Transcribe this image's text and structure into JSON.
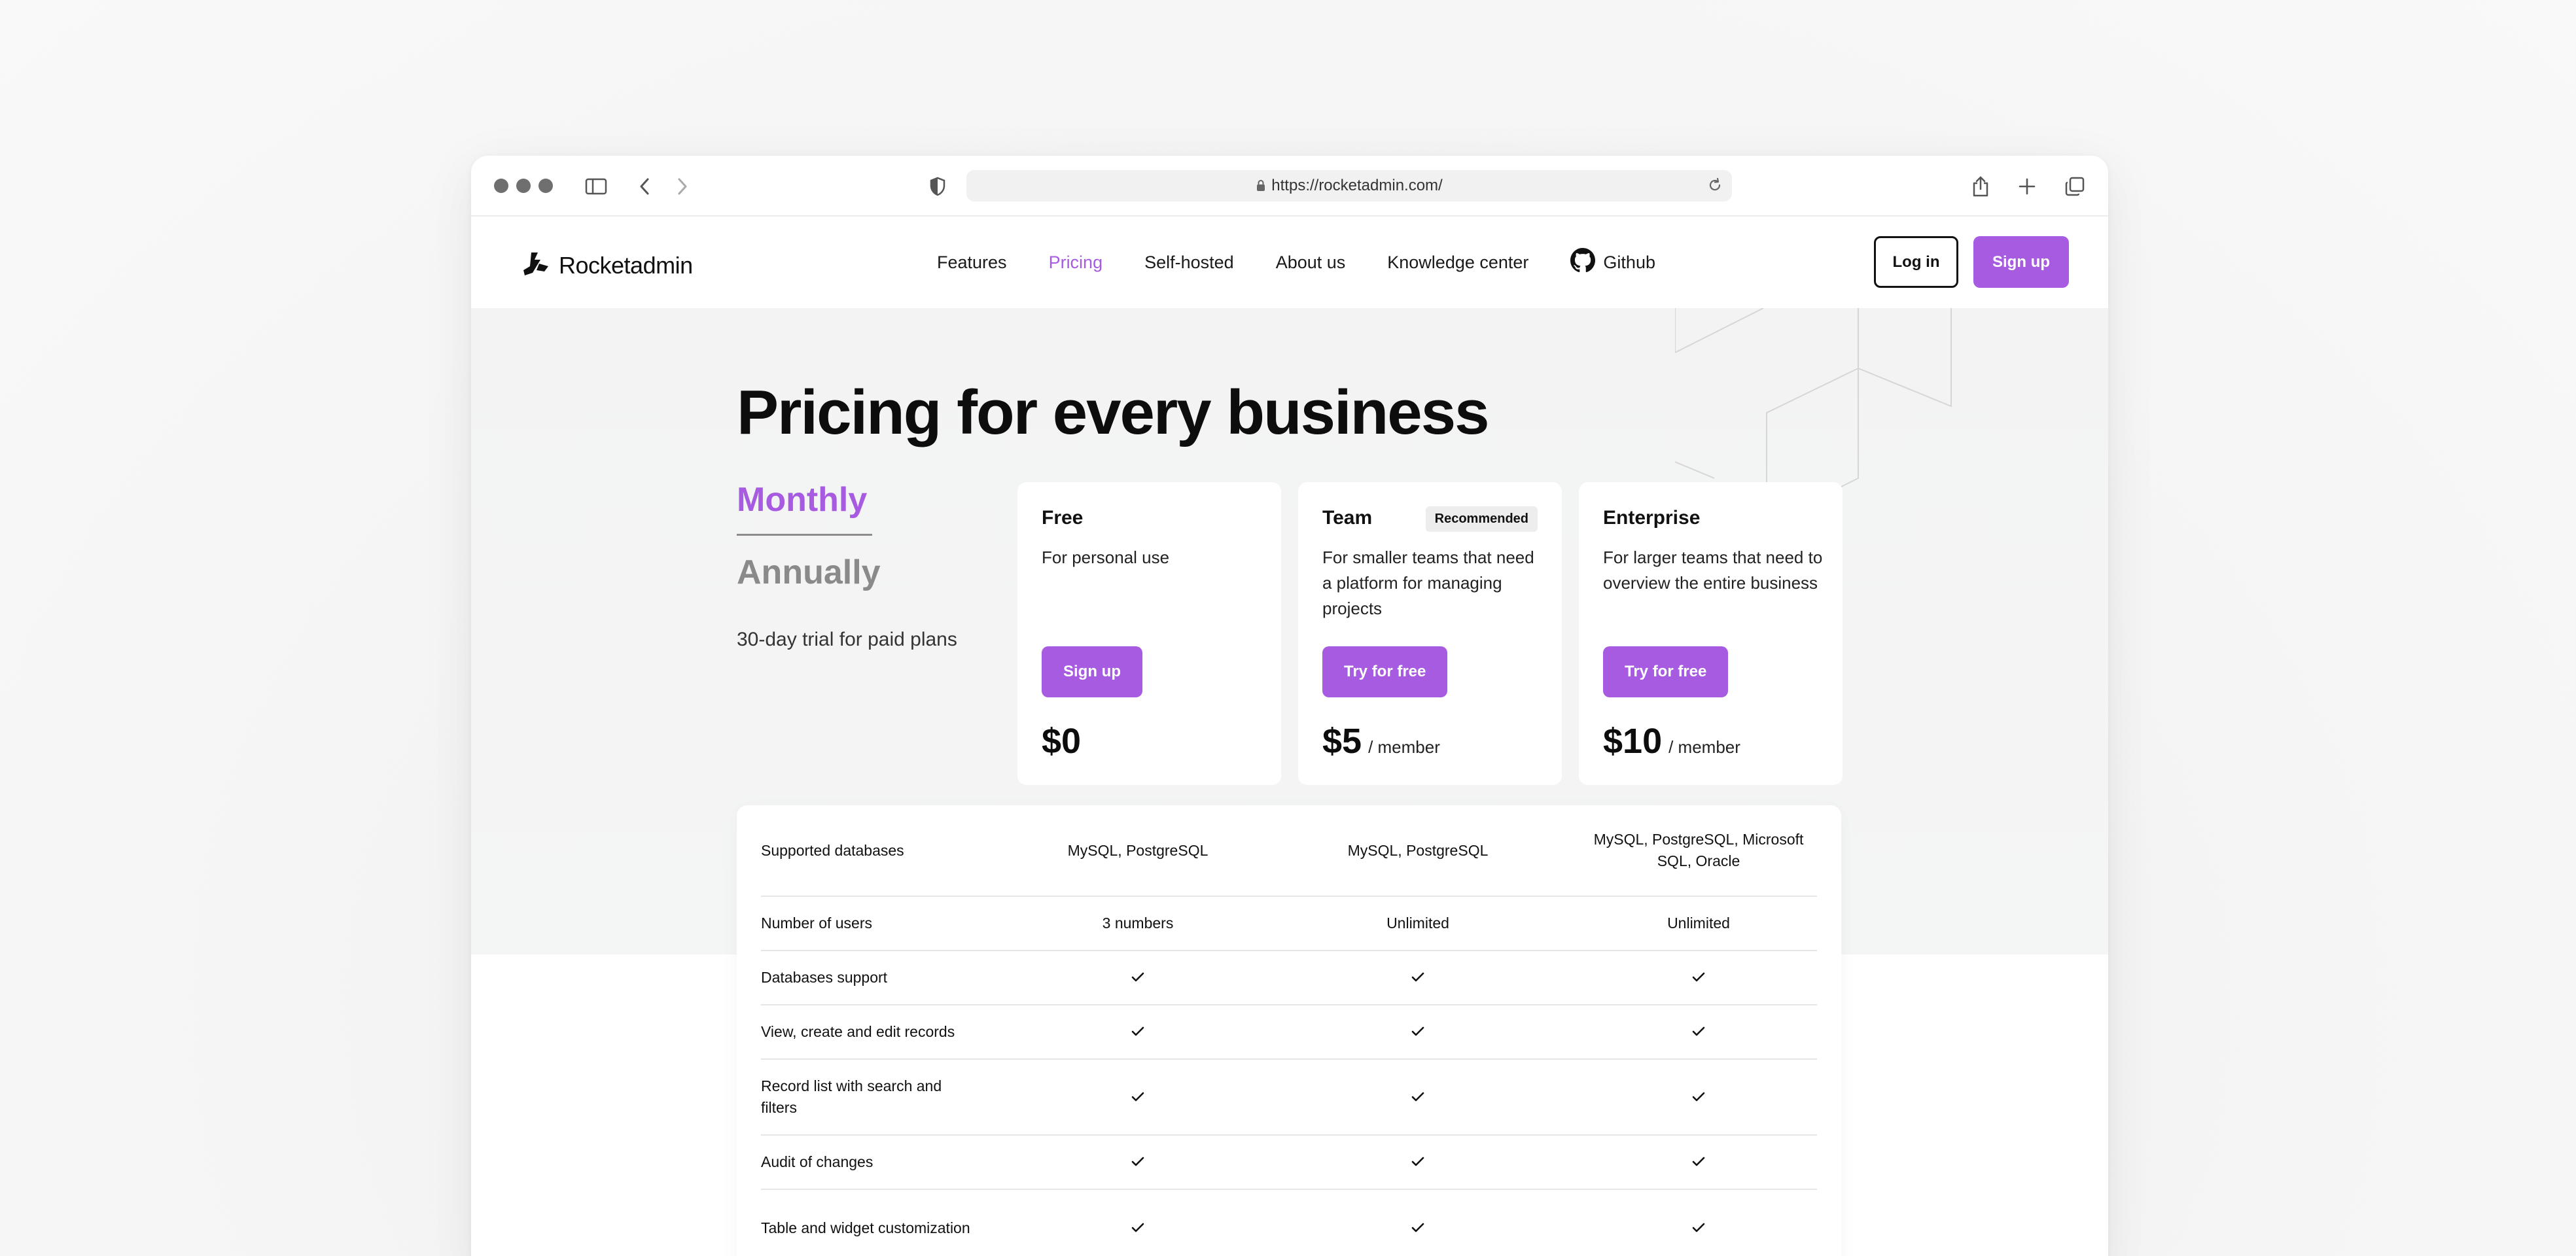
{
  "browser": {
    "url": "https://rocketadmin.com/"
  },
  "site": {
    "logo_text": "Rocketadmin",
    "nav": [
      {
        "label": "Features",
        "active": false
      },
      {
        "label": "Pricing",
        "active": true
      },
      {
        "label": "Self-hosted",
        "active": false
      },
      {
        "label": "About us",
        "active": false
      },
      {
        "label": "Knowledge center",
        "active": false
      }
    ],
    "github_label": "Github",
    "login_label": "Log in",
    "signup_label": "Sign up"
  },
  "hero": {
    "title": "Pricing for every business",
    "period_monthly": "Monthly",
    "period_annually": "Annually",
    "trial_note": "30-day trial for paid plans"
  },
  "plans": [
    {
      "name": "Free",
      "description": "For personal use",
      "button": "Sign up",
      "price": "$0",
      "unit": "",
      "badge": ""
    },
    {
      "name": "Team",
      "description": "For smaller teams that need a platform for managing projects",
      "button": "Try for free",
      "price": "$5",
      "unit": "/ member",
      "badge": "Recommended"
    },
    {
      "name": "Enterprise",
      "description": "For larger teams that need to overview the entire business",
      "button": "Try for free",
      "price": "$10",
      "unit": "/ member",
      "badge": ""
    }
  ],
  "features": [
    {
      "label": "Supported databases",
      "values": [
        "MySQL, PostgreSQL",
        "MySQL, PostgreSQL",
        "MySQL, PostgreSQL, Microsoft SQL, Oracle"
      ]
    },
    {
      "label": "Number of users",
      "values": [
        "3 numbers",
        "Unlimited",
        "Unlimited"
      ]
    },
    {
      "label": "Databases support",
      "values": [
        "check",
        "check",
        "check"
      ]
    },
    {
      "label": "View, create and edit records",
      "values": [
        "check",
        "check",
        "check"
      ]
    },
    {
      "label": "Record list with search and filters",
      "values": [
        "check",
        "check",
        "check"
      ]
    },
    {
      "label": "Audit of changes",
      "values": [
        "check",
        "check",
        "check"
      ]
    },
    {
      "label": "Table and widget customization",
      "values": [
        "check",
        "check",
        "check"
      ]
    }
  ],
  "colors": {
    "accent": "#a65be0",
    "inactive": "#8a8a8a"
  },
  "icons": {
    "check": "check-icon",
    "github": "github-icon",
    "logo": "rocket-logo-icon"
  }
}
